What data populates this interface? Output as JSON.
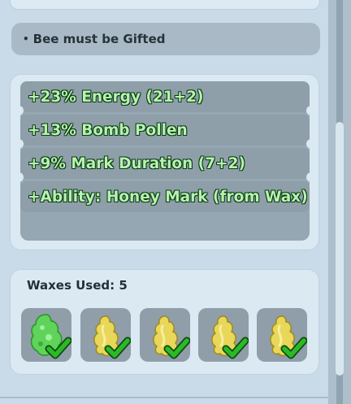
{
  "requirement": {
    "bullet": "•",
    "text": "Bee must be Gifted"
  },
  "stats": [
    {
      "text": "+23% Energy (21+2)"
    },
    {
      "text": "+13% Bomb Pollen"
    },
    {
      "text": "+9% Mark Duration (7+2)"
    },
    {
      "text": "+Ability: Honey Mark (from Wax)"
    }
  ],
  "waxes": {
    "label": "Waxes Used: 5",
    "items": [
      {
        "icon": "green-wax-icon",
        "color": "#5fd35a",
        "status": "checkmark-icon"
      },
      {
        "icon": "yellow-wax-icon",
        "color": "#e9d75a",
        "status": "checkmark-icon"
      },
      {
        "icon": "yellow-wax-icon",
        "color": "#e9d75a",
        "status": "checkmark-icon"
      },
      {
        "icon": "yellow-wax-icon",
        "color": "#e9d75a",
        "status": "checkmark-icon"
      },
      {
        "icon": "yellow-wax-icon",
        "color": "#e9d75a",
        "status": "checkmark-icon"
      }
    ]
  },
  "colors": {
    "stat_text": "#b6f2b0",
    "check": "#2db82a",
    "panel": "#dbe9f3"
  }
}
